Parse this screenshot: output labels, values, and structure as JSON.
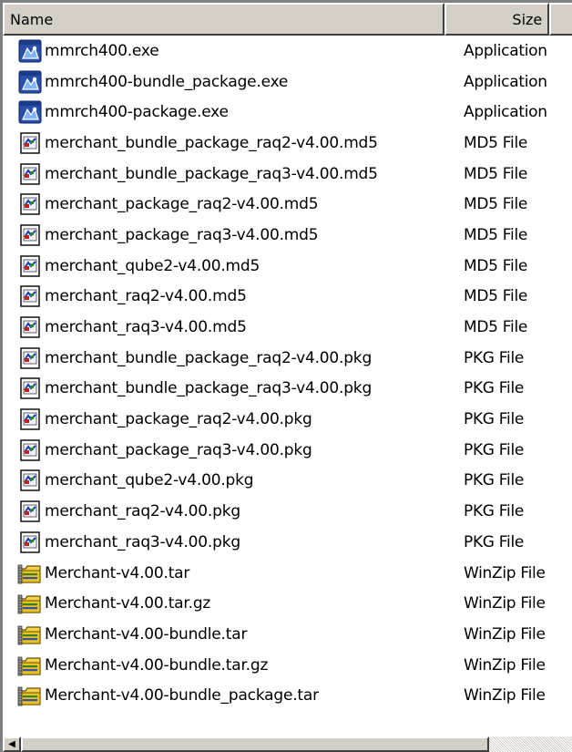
{
  "header": {
    "name_label": "Name",
    "size_label": "Size"
  },
  "files": [
    {
      "name": "mmrch400.exe",
      "type": "Application",
      "icon": "application-icon"
    },
    {
      "name": "mmrch400-bundle_package.exe",
      "type": "Application",
      "icon": "application-icon"
    },
    {
      "name": "mmrch400-package.exe",
      "type": "Application",
      "icon": "application-icon"
    },
    {
      "name": "merchant_bundle_package_raq2-v4.00.md5",
      "type": "MD5 File",
      "icon": "generic-file-icon"
    },
    {
      "name": "merchant_bundle_package_raq3-v4.00.md5",
      "type": "MD5 File",
      "icon": "generic-file-icon"
    },
    {
      "name": "merchant_package_raq2-v4.00.md5",
      "type": "MD5 File",
      "icon": "generic-file-icon"
    },
    {
      "name": "merchant_package_raq3-v4.00.md5",
      "type": "MD5 File",
      "icon": "generic-file-icon"
    },
    {
      "name": "merchant_qube2-v4.00.md5",
      "type": "MD5 File",
      "icon": "generic-file-icon"
    },
    {
      "name": "merchant_raq2-v4.00.md5",
      "type": "MD5 File",
      "icon": "generic-file-icon"
    },
    {
      "name": "merchant_raq3-v4.00.md5",
      "type": "MD5 File",
      "icon": "generic-file-icon"
    },
    {
      "name": "merchant_bundle_package_raq2-v4.00.pkg",
      "type": "PKG File",
      "icon": "generic-file-icon"
    },
    {
      "name": "merchant_bundle_package_raq3-v4.00.pkg",
      "type": "PKG File",
      "icon": "generic-file-icon"
    },
    {
      "name": "merchant_package_raq2-v4.00.pkg",
      "type": "PKG File",
      "icon": "generic-file-icon"
    },
    {
      "name": "merchant_package_raq3-v4.00.pkg",
      "type": "PKG File",
      "icon": "generic-file-icon"
    },
    {
      "name": "merchant_qube2-v4.00.pkg",
      "type": "PKG File",
      "icon": "generic-file-icon"
    },
    {
      "name": "merchant_raq2-v4.00.pkg",
      "type": "PKG File",
      "icon": "generic-file-icon"
    },
    {
      "name": "merchant_raq3-v4.00.pkg",
      "type": "PKG File",
      "icon": "generic-file-icon"
    },
    {
      "name": "Merchant-v4.00.tar",
      "type": "WinZip File",
      "icon": "winzip-archive-icon"
    },
    {
      "name": "Merchant-v4.00.tar.gz",
      "type": "WinZip File",
      "icon": "winzip-archive-icon"
    },
    {
      "name": "Merchant-v4.00-bundle.tar",
      "type": "WinZip File",
      "icon": "winzip-archive-icon"
    },
    {
      "name": "Merchant-v4.00-bundle.tar.gz",
      "type": "WinZip File",
      "icon": "winzip-archive-icon"
    },
    {
      "name": "Merchant-v4.00-bundle_package.tar",
      "type": "WinZip File",
      "icon": "winzip-archive-icon"
    }
  ],
  "scrollbar": {
    "left_arrow_glyph": "◀"
  },
  "colors": {
    "header_bg": "#d4d0c8",
    "border_dark": "#404040",
    "border_light": "#ffffff",
    "list_bg": "#ffffff"
  }
}
